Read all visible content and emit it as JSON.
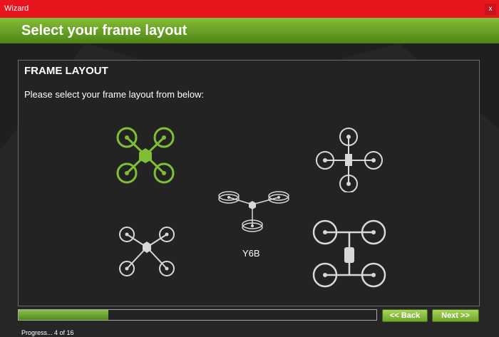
{
  "window": {
    "title": "Wizard",
    "close_label": "x"
  },
  "header": {
    "title": "Select your frame layout"
  },
  "panel": {
    "title": "FRAME LAYOUT",
    "description": "Please select your frame layout from below:",
    "frames": [
      {
        "name": "quad-x",
        "label": "",
        "selected": true,
        "icon": "quad-x-frame-icon"
      },
      {
        "name": "quad-plus",
        "label": "",
        "selected": false,
        "icon": "quad-plus-frame-icon"
      },
      {
        "name": "y6b",
        "label": "Y6B",
        "selected": false,
        "icon": "y6b-frame-icon"
      },
      {
        "name": "quad-x-alt",
        "label": "",
        "selected": false,
        "icon": "quad-x-frame-icon"
      },
      {
        "name": "quad-h",
        "label": "",
        "selected": false,
        "icon": "quad-h-frame-icon"
      }
    ]
  },
  "footer": {
    "progress_fraction": 0.25,
    "back_label": "<< Back",
    "next_label": "Next >>",
    "status_text": "Progress... 4 of 16"
  },
  "colors": {
    "titlebar": "#e8141e",
    "header_top": "#86bd39",
    "header_bottom": "#4e8514",
    "selected": "#7fbf35",
    "unselected": "#d8d8d8",
    "background": "#1f1f1f"
  }
}
